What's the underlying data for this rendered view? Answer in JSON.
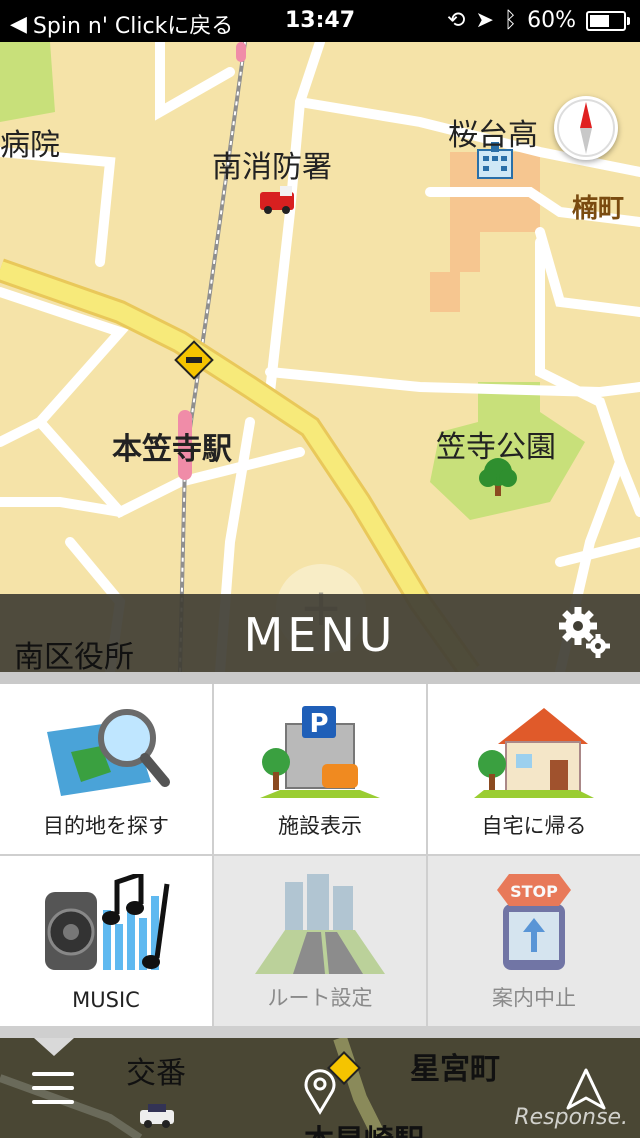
{
  "status_bar": {
    "back_label": "Spin n' Clickに戻る",
    "time": "13:47",
    "battery_percent": "60%",
    "battery_level": 0.6
  },
  "map": {
    "labels": {
      "hospital": "病院",
      "fire_station": "南消防署",
      "school": "桜台高",
      "town": "楠町",
      "station": "本笠寺駅",
      "park": "笠寺公園"
    },
    "zoom_label": "+"
  },
  "menu_bar": {
    "title": "MENU",
    "place_label": "南区役所"
  },
  "menu": {
    "items": [
      {
        "label": "目的地を探す",
        "icon": "map-search-icon",
        "enabled": true
      },
      {
        "label": "施設表示",
        "icon": "parking-facility-icon",
        "enabled": true
      },
      {
        "label": "自宅に帰る",
        "icon": "home-icon",
        "enabled": true
      },
      {
        "label": "MUSIC",
        "icon": "music-icon",
        "enabled": true
      },
      {
        "label": "ルート設定",
        "icon": "route-icon",
        "enabled": false
      },
      {
        "label": "案内中止",
        "icon": "stop-guidance-icon",
        "enabled": false
      }
    ]
  },
  "bottom_bar": {
    "labels": {
      "police_box": "交番",
      "town": "星宮町",
      "station": "本星崎駅"
    }
  },
  "watermark": "Response.",
  "colors": {
    "map_background": "#f5e3a8",
    "major_road": "#f7ea7a",
    "park": "#c8e07a",
    "menu_bar": "#403e34"
  }
}
